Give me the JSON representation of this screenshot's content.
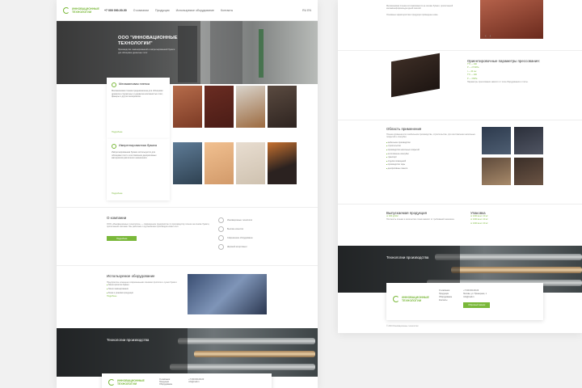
{
  "left": {
    "header": {
      "logo": "ИННОВАЦИОННЫЕ ТЕХНОЛОГИИ",
      "phone": "+7 000 000-00-00",
      "nav": [
        "О компании",
        "Продукция",
        "Используемое оборудование",
        "Контакты"
      ],
      "lang": "RU EN"
    },
    "hero": {
      "title": "ООО \"ИННОВАЦИОННЫЕ ТЕХНОЛОГИИ\"",
      "subtitle": "Производство ламинированной и импрегнированной бумаги для облицовки древесных плит"
    },
    "products": [
      {
        "title": "Меламиновая пленка",
        "text": "Меламиновая пленка предназначена для облицовки древесно-стружечных и древесно-волокнистых плит, фанеры и других материалов.",
        "more": "Подробнее",
        "images": [
          "",
          "",
          "",
          ""
        ]
      },
      {
        "title": "Импрегнированная бумага",
        "text": "Импрегнированная бумага используется для облицовки плит и изготовления декоративных материалов различного назначения.",
        "more": "Подробнее",
        "images": [
          "",
          "",
          "",
          ""
        ]
      }
    ],
    "about": {
      "title": "О компании",
      "text": "ООО «Инновационные технологии» — современное предприятие по производству пленок на основе бумаги, пропитанной смолами. Мы работаем с крупнейшими производителями плит.",
      "button": "Подробнее",
      "icons": [
        "Инновационные технологии",
        "Высокое качество",
        "Современное оборудование",
        "Широкий ассортимент"
      ]
    },
    "equipment": {
      "title": "Используемое оборудование",
      "text": "Предприятие оснащено современными линиями пропитки и сушки бумаги.",
      "bullets": [
        "Линия пропитки бумаги",
        "Линия ламинирования",
        "Резка и упаковка продукции"
      ],
      "more": "Подробнее"
    },
    "tech": {
      "title": "Технологии производства"
    },
    "footer": {
      "logo": "ИННОВАЦИОННЫЕ ТЕХНОЛОГИИ",
      "links": [
        "О компании",
        "Продукция",
        "Оборудование"
      ],
      "contacts": [
        "+7 000 000-00-00",
        "info@mail.ru"
      ]
    }
  },
  "right": {
    "intro": {
      "text": "Меламиновая пленка изготавливается на основе бумаги, пропитанной меламиноформальдегидной смолой.",
      "text2": "Основные характеристики продукции приведены ниже."
    },
    "params": {
      "title": "Ориентировочные параметры прессования:",
      "items": [
        "T°C — 190",
        "Р — 2.5 МПа",
        "t — 40 сек",
        "T°C — 200",
        "Р — 3 МПа"
      ],
      "note": "Параметры прессования зависят от типа оборудования и плиты."
    },
    "application": {
      "title": "Область применения",
      "text": "Пленка применяется в мебельном производстве, строительстве, при изготовлении напольных покрытий и опалубки.",
      "bullets": [
        "мебельное производство",
        "строительство",
        "производство напольных покрытий",
        "изготовление опалубки",
        "транспорт",
        "отделка помещений",
        "производство тары",
        "декоративные панели"
      ]
    },
    "produced": {
      "title": "Выпускаемая продукция",
      "price": "от 000 руб/м²",
      "text": "Плотность пленки и количество слоев зависят от требований заказчика."
    },
    "packaging": {
      "title": "Упаковка",
      "items": [
        "от 1000 кв.м / 40 м²",
        "от 1000 кв.м / 40 м²",
        "от 1000 кв.м / 40 м²"
      ]
    },
    "tech": {
      "title": "Технологии производства"
    },
    "footer": {
      "logo": "ИННОВАЦИОННЫЕ ТЕХНОЛОГИИ",
      "links": [
        "О компании",
        "Продукция",
        "Оборудование",
        "Контакты"
      ],
      "contacts": [
        "+7 000 000-00-00",
        "Москва, ул. Примерная, 1",
        "info@mail.ru"
      ],
      "button": "Обратный звонок",
      "copyright": "© 2016 Инновационные технологии"
    }
  },
  "colors": {
    "accent": "#7ab83a",
    "background": "#f1f1f1"
  }
}
